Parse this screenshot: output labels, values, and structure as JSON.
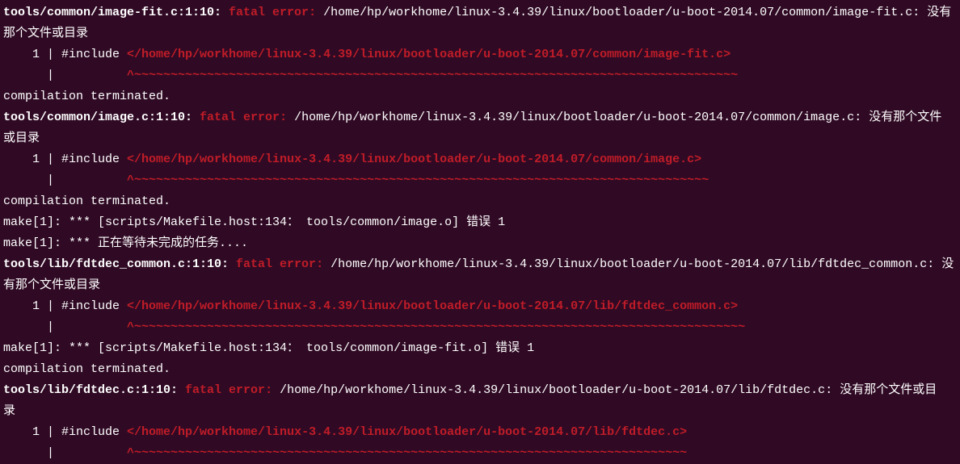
{
  "colors": {
    "background": "#300a24",
    "foreground": "#ffffff",
    "error": "#c01c28"
  },
  "lines": [
    [
      {
        "t": "tools/common/image-fit.c:1:10: ",
        "c": "bold"
      },
      {
        "t": "fatal error: ",
        "c": "red"
      },
      {
        "t": "/home/hp/workhome/linux-3.4.39/linux/bootloader/u-boot-2014.07/common/image-fit.c: 没有",
        "c": "plain"
      }
    ],
    [
      {
        "t": "那个文件或目录",
        "c": "plain"
      }
    ],
    [
      {
        "t": "    1 | #include ",
        "c": "plain"
      },
      {
        "t": "</home/hp/workhome/linux-3.4.39/linux/bootloader/u-boot-2014.07/common/image-fit.c>",
        "c": "red"
      }
    ],
    [
      {
        "t": "      |          ",
        "c": "plain"
      },
      {
        "t": "^~~~~~~~~~~~~~~~~~~~~~~~~~~~~~~~~~~~~~~~~~~~~~~~~~~~~~~~~~~~~~~~~~~~~~~~~~~~~~~~~~~~",
        "c": "red"
      }
    ],
    [
      {
        "t": "compilation terminated.",
        "c": "plain"
      }
    ],
    [
      {
        "t": "tools/common/image.c:1:10: ",
        "c": "bold"
      },
      {
        "t": "fatal error: ",
        "c": "red"
      },
      {
        "t": "/home/hp/workhome/linux-3.4.39/linux/bootloader/u-boot-2014.07/common/image.c: 没有那个文件",
        "c": "plain"
      }
    ],
    [
      {
        "t": "或目录",
        "c": "plain"
      }
    ],
    [
      {
        "t": "    1 | #include ",
        "c": "plain"
      },
      {
        "t": "</home/hp/workhome/linux-3.4.39/linux/bootloader/u-boot-2014.07/common/image.c>",
        "c": "red"
      }
    ],
    [
      {
        "t": "      |          ",
        "c": "plain"
      },
      {
        "t": "^~~~~~~~~~~~~~~~~~~~~~~~~~~~~~~~~~~~~~~~~~~~~~~~~~~~~~~~~~~~~~~~~~~~~~~~~~~~~~~~",
        "c": "red"
      }
    ],
    [
      {
        "t": "compilation terminated.",
        "c": "plain"
      }
    ],
    [
      {
        "t": "make[1]: *** [scripts/Makefile.host:134： tools/common/image.o] 错误 1",
        "c": "plain"
      }
    ],
    [
      {
        "t": "make[1]: *** 正在等待未完成的任务....",
        "c": "plain"
      }
    ],
    [
      {
        "t": "tools/lib/fdtdec_common.c:1:10: ",
        "c": "bold"
      },
      {
        "t": "fatal error: ",
        "c": "red"
      },
      {
        "t": "/home/hp/workhome/linux-3.4.39/linux/bootloader/u-boot-2014.07/lib/fdtdec_common.c: 没",
        "c": "plain"
      }
    ],
    [
      {
        "t": "有那个文件或目录",
        "c": "plain"
      }
    ],
    [
      {
        "t": "    1 | #include ",
        "c": "plain"
      },
      {
        "t": "</home/hp/workhome/linux-3.4.39/linux/bootloader/u-boot-2014.07/lib/fdtdec_common.c>",
        "c": "red"
      }
    ],
    [
      {
        "t": "      |          ",
        "c": "plain"
      },
      {
        "t": "^~~~~~~~~~~~~~~~~~~~~~~~~~~~~~~~~~~~~~~~~~~~~~~~~~~~~~~~~~~~~~~~~~~~~~~~~~~~~~~~~~~~~",
        "c": "red"
      }
    ],
    [
      {
        "t": "make[1]: *** [scripts/Makefile.host:134： tools/common/image-fit.o] 错误 1",
        "c": "plain"
      }
    ],
    [
      {
        "t": "compilation terminated.",
        "c": "plain"
      }
    ],
    [
      {
        "t": "tools/lib/fdtdec.c:1:10: ",
        "c": "bold"
      },
      {
        "t": "fatal error: ",
        "c": "red"
      },
      {
        "t": "/home/hp/workhome/linux-3.4.39/linux/bootloader/u-boot-2014.07/lib/fdtdec.c: 没有那个文件或目",
        "c": "plain"
      }
    ],
    [
      {
        "t": "录",
        "c": "plain"
      }
    ],
    [
      {
        "t": "    1 | #include ",
        "c": "plain"
      },
      {
        "t": "</home/hp/workhome/linux-3.4.39/linux/bootloader/u-boot-2014.07/lib/fdtdec.c>",
        "c": "red"
      }
    ],
    [
      {
        "t": "      |          ",
        "c": "plain"
      },
      {
        "t": "^~~~~~~~~~~~~~~~~~~~~~~~~~~~~~~~~~~~~~~~~~~~~~~~~~~~~~~~~~~~~~~~~~~~~~~~~~~~~",
        "c": "red"
      }
    ]
  ]
}
